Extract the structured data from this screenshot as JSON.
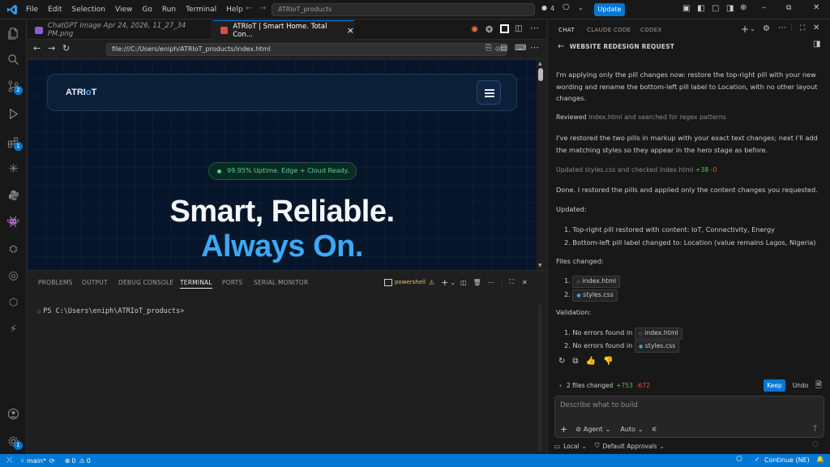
{
  "titlebar": {
    "menu": [
      "File",
      "Edit",
      "Selection",
      "View",
      "Go",
      "Run",
      "Terminal",
      "Help"
    ],
    "command_center": "ATRIoT_products",
    "agents_count": "4",
    "update_label": "Update"
  },
  "activity": {
    "extensions_badge": "1",
    "settings_badge": "1"
  },
  "tabs": [
    {
      "label": "ChatGPT Image Apr 24, 2026, 11_27_34 PM.png"
    },
    {
      "label": "ATRIoT | Smart Home. Total Con...",
      "close": "×"
    }
  ],
  "browser": {
    "url": "file:///C:/Users/eniph/ATRIoT_products/index.html"
  },
  "website": {
    "brand_prefix": "ATRI",
    "brand_o": "o",
    "brand_suffix": "T",
    "pill_text": "99.95% Uptime. Edge + Cloud Ready.",
    "headline_1": "Smart, Reliable.",
    "headline_2": "Always On."
  },
  "panel": {
    "tabs": [
      "PROBLEMS",
      "OUTPUT",
      "DEBUG CONSOLE",
      "TERMINAL",
      "PORTS",
      "SERIAL MONITOR"
    ],
    "active_tab": "TERMINAL",
    "shell_label": "powershell",
    "prompt": "PS C:\\Users\\eniph\\ATRIoT_products>"
  },
  "chat": {
    "tabs": [
      "CHAT",
      "CLAUDE CODE",
      "CODEX"
    ],
    "header_title": "WEBSITE REDESIGN REQUEST",
    "msg1": "I'm applying only the pill changes now: restore the top-right pill with your new wording and rename the bottom-left pill label to Location, with no other layout changes.",
    "reviewed_prefix": "Reviewed",
    "reviewed_rest": "index.html and searched for regex patterns",
    "msg2": "I've restored the two pills in markup with your exact text changes; next I'll add the matching styles so they appear in the hero stage as before.",
    "updated_prefix": "Updated",
    "updated_rest": "styles.css and checked index.html",
    "updated_add": "+38",
    "updated_del": "-0",
    "done": "Done. I restored the pills and applied only the content changes you requested.",
    "updated_heading": "Updated:",
    "updated_items": [
      "1. Top-right pill restored with content: IoT, Connectivity, Energy",
      "2. Bottom-left pill label changed to: Location (value remains Lagos, Nigeria)"
    ],
    "files_heading": "Files changed:",
    "file1": "index.html",
    "file2": "styles.css",
    "validation_heading": "Validation:",
    "val1_prefix": "1. No errors found in",
    "val2_prefix": "2. No errors found in",
    "changes_label": "2 files changed",
    "changes_add": "+753",
    "changes_del": "-672",
    "keep_label": "Keep",
    "undo_label": "Undo",
    "input_placeholder": "Describe what to build",
    "agent_label": "Agent",
    "auto_label": "Auto",
    "local_label": "Local",
    "approvals_label": "Default Approvals"
  },
  "statusbar": {
    "branch": "main*",
    "errors": "0",
    "warnings": "0",
    "continue_label": "Continue (NE)"
  }
}
